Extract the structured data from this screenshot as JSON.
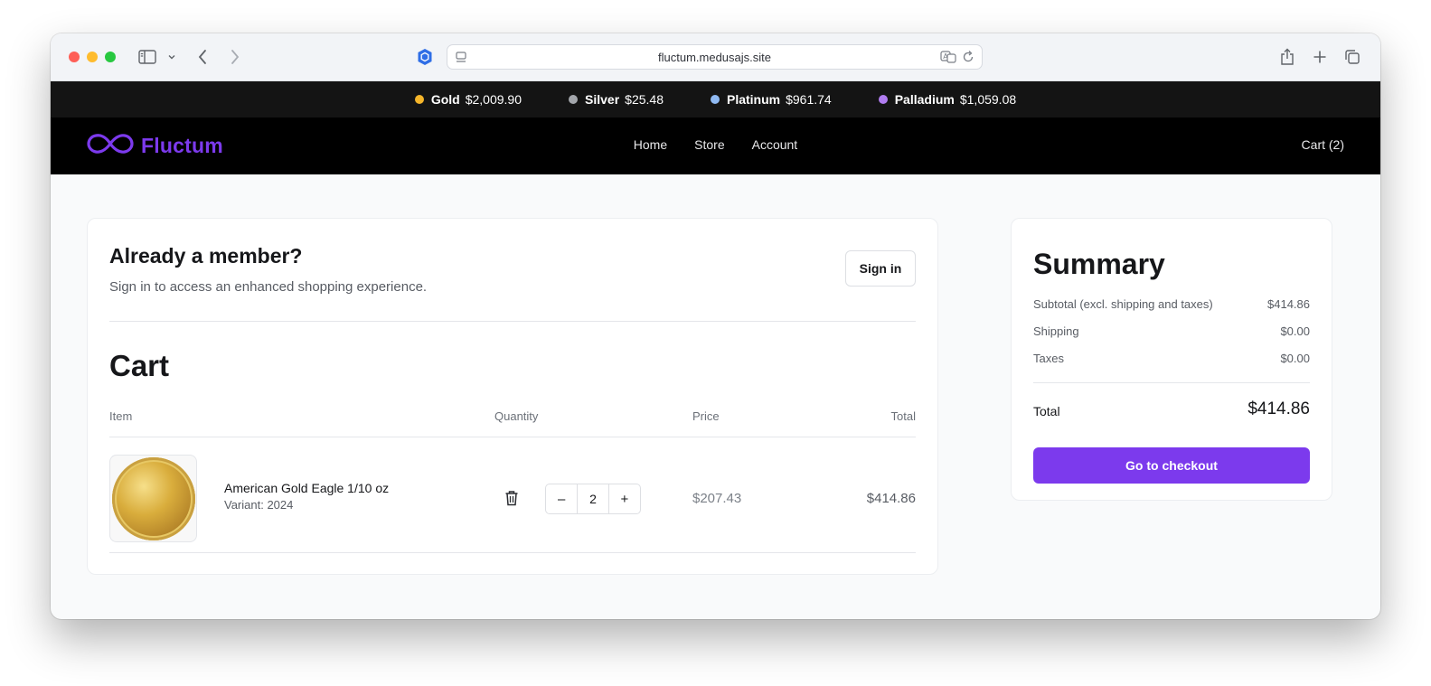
{
  "browser": {
    "url": "fluctum.medusajs.site"
  },
  "ticker": [
    {
      "name": "Gold",
      "price": "$2,009.90",
      "color": "#f5b52a"
    },
    {
      "name": "Silver",
      "price": "$25.48",
      "color": "#a3a6ab"
    },
    {
      "name": "Platinum",
      "price": "$961.74",
      "color": "#8fb9f2"
    },
    {
      "name": "Palladium",
      "price": "$1,059.08",
      "color": "#b07cf0"
    }
  ],
  "header": {
    "brand": "Fluctum",
    "brand_color": "#7c3aed",
    "nav": [
      "Home",
      "Store",
      "Account"
    ],
    "cart_label": "Cart (2)"
  },
  "member": {
    "title": "Already a member?",
    "subtitle": "Sign in to access an enhanced shopping experience.",
    "signin_label": "Sign in"
  },
  "cart": {
    "title": "Cart",
    "columns": {
      "item": "Item",
      "quantity": "Quantity",
      "price": "Price",
      "total": "Total"
    },
    "items": [
      {
        "name": "American Gold Eagle 1/10 oz",
        "variant": "Variant: 2024",
        "quantity": "2",
        "unit_price": "$207.43",
        "total": "$414.86",
        "decrement": "–",
        "increment": "+"
      }
    ]
  },
  "summary": {
    "title": "Summary",
    "rows": [
      {
        "label": "Subtotal (excl. shipping and taxes)",
        "value": "$414.86"
      },
      {
        "label": "Shipping",
        "value": "$0.00"
      },
      {
        "label": "Taxes",
        "value": "$0.00"
      }
    ],
    "total_label": "Total",
    "total_value": "$414.86",
    "checkout_label": "Go to checkout"
  }
}
